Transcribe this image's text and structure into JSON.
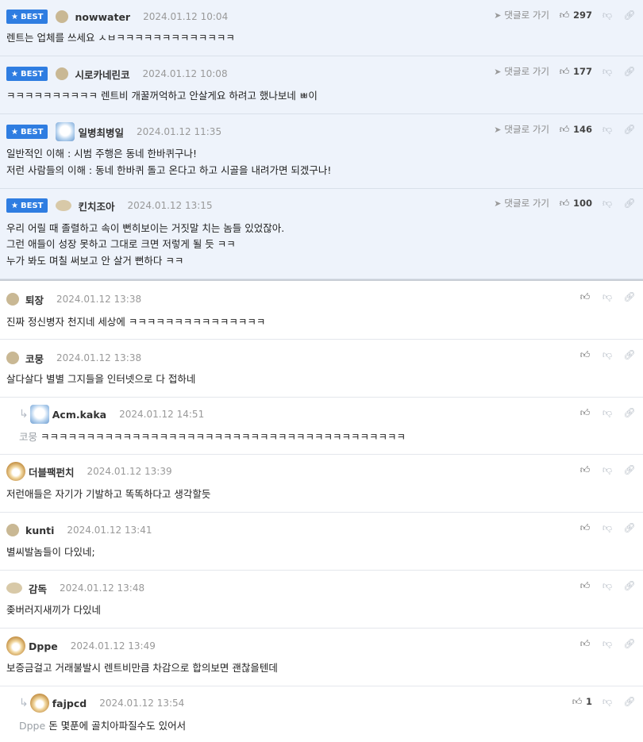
{
  "best_badge": "BEST",
  "goto_label": "댓글로 가기",
  "best_comments": [
    {
      "nick": "nowwater",
      "date": "2024.01.12 10:04",
      "likes": "297",
      "lines": [
        "렌트는 업체를 쓰세요 ㅅㅂㅋㅋㅋㅋㅋㅋㅋㅋㅋㅋㅋㅋㅋ"
      ]
    },
    {
      "nick": "시로카네린코",
      "date": "2024.01.12 10:08",
      "likes": "177",
      "lines": [
        "ㅋㅋㅋㅋㅋㅋㅋㅋㅋㅋ 렌트비 개꿀꺼억하고 안살게요 하려고 했나보네 ㅃ이"
      ]
    },
    {
      "nick": "일병최병일",
      "date": "2024.01.12 11:35",
      "likes": "146",
      "lines": [
        "일반적인 이해 : 시범 주행은 동네 한바퀴구나!",
        "저런 사람들의 이해 : 동네 한바퀴 돌고 온다고 하고 시골을 내려가면 되겠구나!"
      ]
    },
    {
      "nick": "킨치조아",
      "date": "2024.01.12 13:15",
      "likes": "100",
      "lines": [
        "우리 어릴 때 졸렬하고 속이 뻔히보이는 거짓말 치는 놈들 있었잖아.",
        "그런 애들이 성장 못하고 그대로 크면 저렇게 될 듯 ㅋㅋ",
        "누가 봐도 며칠 써보고 안 살거 뻔하다 ㅋㅋ"
      ]
    }
  ],
  "comments": [
    {
      "nick": "퇴장",
      "date": "2024.01.12 13:38",
      "text": "진짜 정신병자 천지네 세상에 ㅋㅋㅋㅋㅋㅋㅋㅋㅋㅋㅋㅋㅋㅋㅋ"
    },
    {
      "nick": "코뭉",
      "date": "2024.01.12 13:38",
      "text": "살다살다 별별 그지들을 인터넷으로 다 접하네"
    },
    {
      "nick": "Acm.kaka",
      "date": "2024.01.12 14:51",
      "mention": "코뭉",
      "text": "ㅋㅋㅋㅋㅋㅋㅋㅋㅋㅋㅋㅋㅋㅋㅋㅋㅋㅋㅋㅋㅋㅋㅋㅋㅋㅋㅋㅋㅋㅋㅋㅋㅋㅋㅋㅋㅋㅋㅋㅋ"
    },
    {
      "nick": "더블팩펀치",
      "date": "2024.01.12 13:39",
      "text": "저런애들은 자기가 기발하고 똑똑하다고 생각할듯"
    },
    {
      "nick": "kunti",
      "date": "2024.01.12 13:41",
      "text": "별씨발놈들이 다있네;"
    },
    {
      "nick": "감독",
      "date": "2024.01.12 13:48",
      "text": "좆버러지새끼가 다있네"
    },
    {
      "nick": "Dppe",
      "date": "2024.01.12 13:49",
      "text": "보증금걸고 거래불발시 렌트비만큼 차감으로 합의보면 괜찮을텐데"
    },
    {
      "nick": "fajpcd",
      "date": "2024.01.12 13:54",
      "mention": "Dppe",
      "likes": "1",
      "text": "돈 몇푼에 골치아파질수도 있어서"
    }
  ],
  "icons": {
    "like": "thumbs-up-icon",
    "dislike": "thumbs-down-icon",
    "link": "link-icon",
    "goto": "arrow-icon",
    "reply": "reply-arrow-icon",
    "star": "star-icon"
  },
  "colors": {
    "best_bg": "#eef3fb",
    "badge": "#2f7de1",
    "border": "#e4e7ec"
  }
}
